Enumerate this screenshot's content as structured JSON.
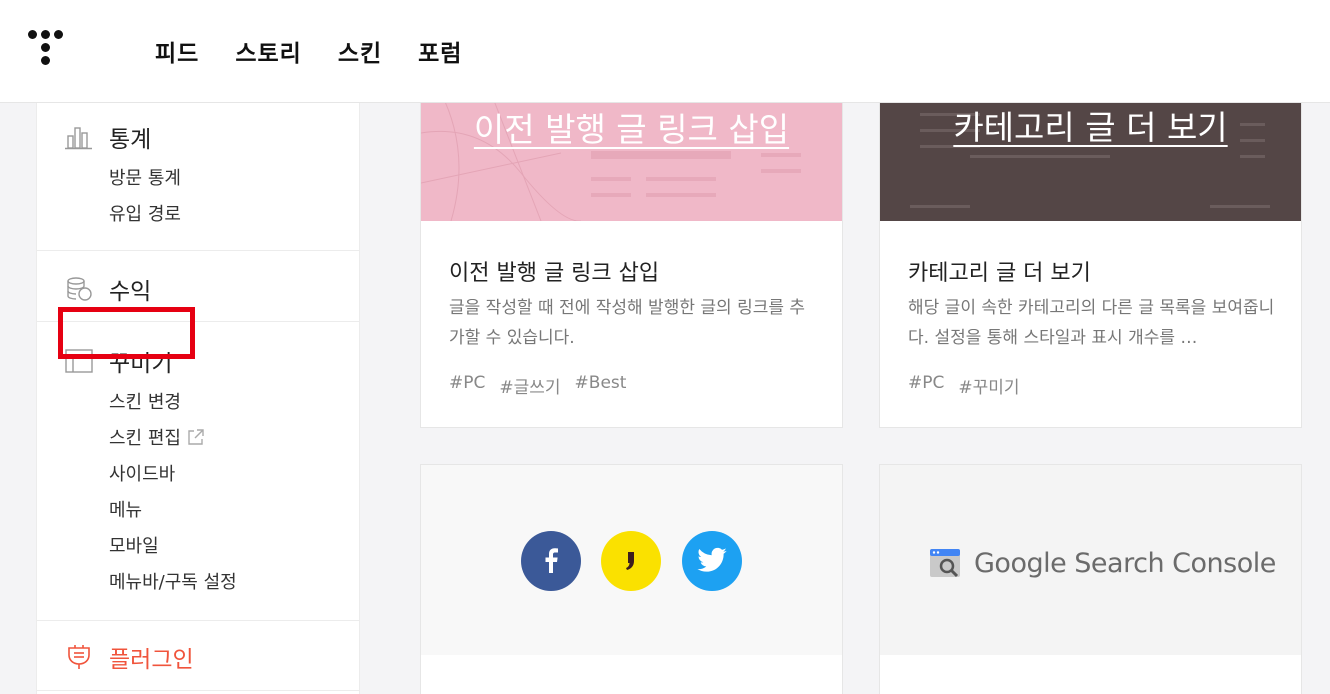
{
  "nav": {
    "items": [
      "피드",
      "스토리",
      "스킨",
      "포럼"
    ]
  },
  "sidebar": {
    "stats": {
      "title": "통계",
      "items": [
        "방문 통계",
        "유입 경로"
      ]
    },
    "revenue": {
      "title": "수익"
    },
    "decorate": {
      "title": "꾸미기",
      "items": [
        "스킨 변경",
        "스킨 편집",
        "사이드바",
        "메뉴",
        "모바일",
        "메뉴바/구독 설정"
      ]
    },
    "plugin": {
      "title": "플러그인"
    }
  },
  "cards": [
    {
      "thumb_text": "이전 발행 글 링크 삽입",
      "title": "이전 발행 글 링크 삽입",
      "desc": "글을 작성할 때 전에 작성해 발행한 글의 링크를 추가할 수 있습니다.",
      "tags": [
        "#PC",
        "#글쓰기",
        "#Best"
      ]
    },
    {
      "thumb_text": "카테고리 글 더 보기",
      "title": "카테고리 글 더 보기",
      "desc": "해당 글이 속한 카테고리의 다른 글 목록을 보여줍니다. 설정을 통해 스타일과 표시 개수를 …",
      "tags": [
        "#PC",
        "#꾸미기"
      ]
    },
    {
      "icons": [
        "facebook-icon",
        "kakao-icon",
        "twitter-icon"
      ]
    },
    {
      "thumb_text": "Google Search Console"
    }
  ],
  "colors": {
    "accent_red": "#e60012",
    "plugin_orange": "#f0543c",
    "pink_thumb": "#f0b8c8",
    "dark_thumb": "#544646",
    "facebook": "#3b5998",
    "kakao": "#fae100",
    "twitter": "#1da1f2"
  }
}
